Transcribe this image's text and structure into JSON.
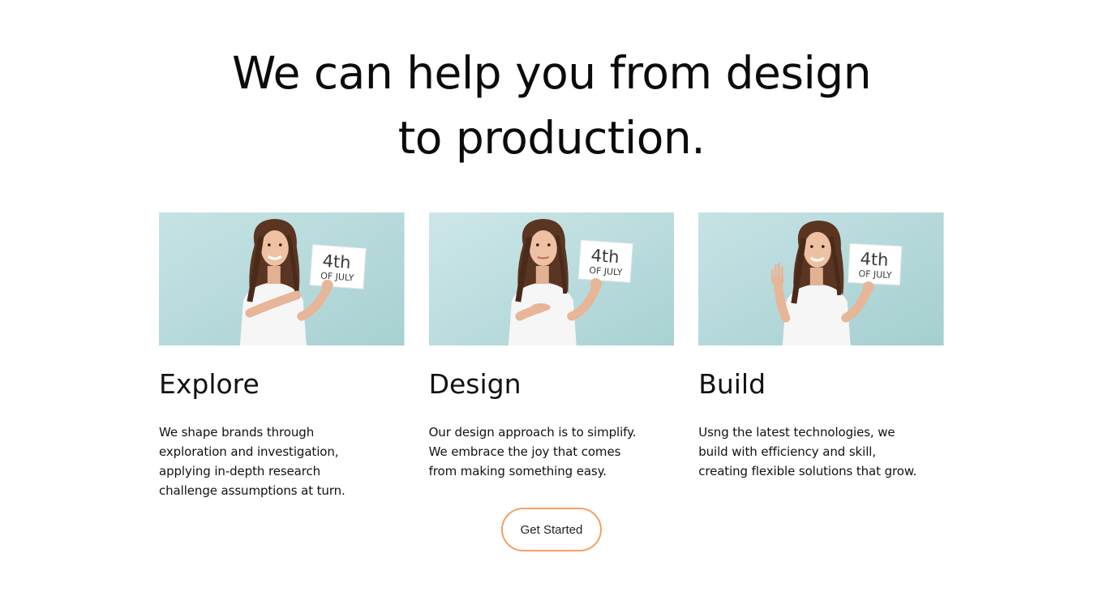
{
  "headline": {
    "line1": "We can help you from design",
    "line2": "to production."
  },
  "cards": [
    {
      "title": "Explore",
      "text": "We shape brands through exploration and investigation, applying in-depth research challenge assumptions at turn.",
      "sign_line1": "4th",
      "sign_line2": "OF JULY",
      "pose": "pointing-at-sign"
    },
    {
      "title": "Design",
      "text": "Our design approach is to simplify. We embrace the joy that comes from making something easy.",
      "sign_line1": "4th",
      "sign_line2": "OF JULY",
      "pose": "open-palm"
    },
    {
      "title": "Build",
      "text": "Usng the latest technologies, we build with efficiency and skill, creating flexible solutions that grow.",
      "sign_line1": "4th",
      "sign_line2": "OF JULY",
      "pose": "four-fingers"
    }
  ],
  "cta": {
    "label": "Get Started"
  },
  "colors": {
    "image_bg": "#b5dadb",
    "cta_border": "#f4a066",
    "text": "#111111"
  }
}
